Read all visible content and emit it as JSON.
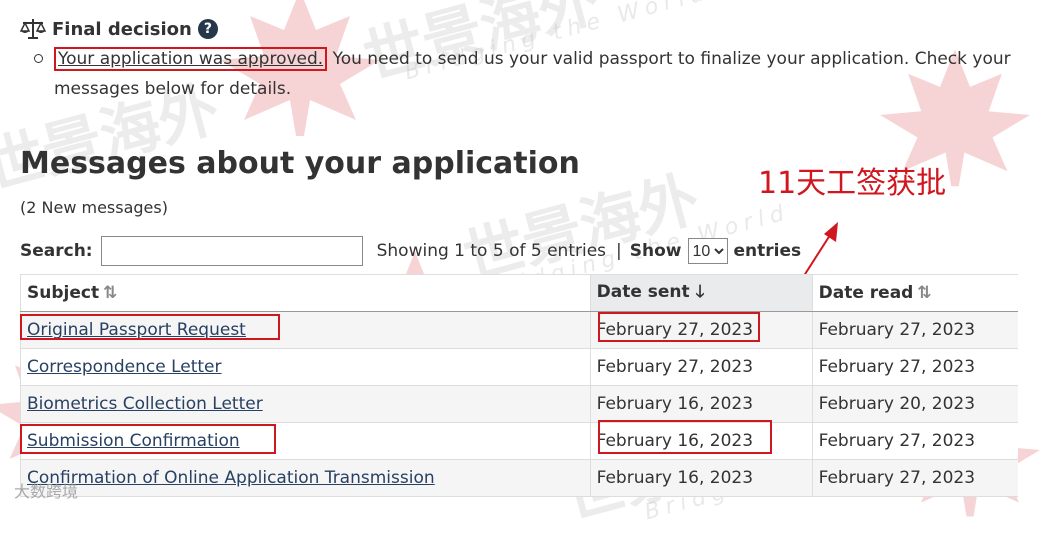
{
  "decision": {
    "title": "Final decision",
    "help_icon": "?",
    "approved_text": "Your application was approved.",
    "rest_text": " You need to send us your valid passport to finalize your application. Check your messages below for details."
  },
  "messages_section": {
    "title": "Messages about your application",
    "new_count": "(2 New messages)"
  },
  "annotation": {
    "text": "11天工签获批",
    "color": "#d0161e"
  },
  "controls": {
    "search_label": "Search:",
    "search_value": "",
    "showing": "Showing 1 to 5 of 5 entries",
    "separator": "|",
    "show_label": "Show",
    "page_length": "10",
    "entries_label": "entries"
  },
  "table": {
    "columns": [
      {
        "label": "Subject",
        "sort_icon": "sort-both-icon"
      },
      {
        "label": "Date sent",
        "sort_icon": "sort-desc-icon"
      },
      {
        "label": "Date read",
        "sort_icon": "sort-both-icon"
      }
    ],
    "rows": [
      {
        "subject": "Original Passport Request",
        "date_sent": "February 27, 2023",
        "date_read": "February 27, 2023"
      },
      {
        "subject": "Correspondence Letter",
        "date_sent": "February 27, 2023",
        "date_read": "February 27, 2023"
      },
      {
        "subject": "Biometrics Collection Letter",
        "date_sent": "February 16, 2023",
        "date_read": "February 20, 2023"
      },
      {
        "subject": "Submission Confirmation",
        "date_sent": "February 16, 2023",
        "date_read": "February 27, 2023"
      },
      {
        "subject": "Confirmation of Online Application Transmission",
        "date_sent": "February 16, 2023",
        "date_read": "February 27, 2023"
      }
    ]
  },
  "watermark": {
    "brand": "世景海外",
    "tagline": "Bridging the World",
    "footer": "大数跨境"
  }
}
